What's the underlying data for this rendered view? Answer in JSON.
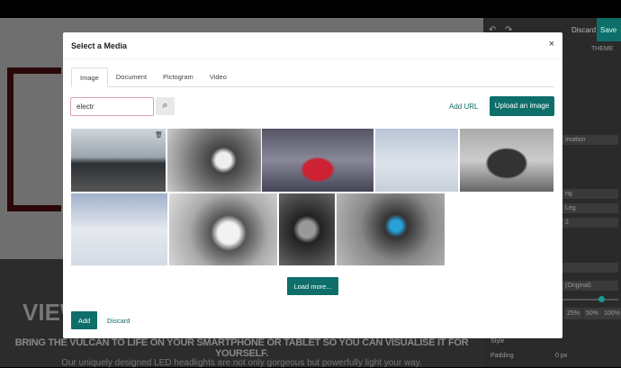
{
  "page": {
    "heading": "VIEW",
    "tagline": "BRING THE VULCAN TO LIFE ON YOUR SMARTPHONE OR TABLET SO YOU CAN VISUALISE IT FOR YOURSELF.",
    "description": "Our uniquely designed LED headlights are not only gorgeous but powerfully light your way."
  },
  "panel": {
    "discard": "Discard",
    "save": "Save",
    "theme": "THEME",
    "rows": [
      "imation",
      "",
      "ng",
      "Leg",
      "2",
      "",
      "(Original)"
    ],
    "percentages": [
      "25%",
      "50%",
      "100%"
    ],
    "style_label": "Style",
    "padding_label": "Padding",
    "padding_value": "0",
    "padding_unit": "px"
  },
  "modal": {
    "title": "Select a Media",
    "close": "×",
    "tabs": [
      {
        "label": "Image",
        "active": true
      },
      {
        "label": "Document"
      },
      {
        "label": "Pictogram"
      },
      {
        "label": "Video"
      }
    ],
    "search": {
      "value": "electr"
    },
    "add_url": "Add URL",
    "upload": "Upload an image",
    "images": [
      "car-highway",
      "ev-charger",
      "red-sports-car-garage",
      "white-suv-snow",
      "black-mustang-road",
      "white-suv-snowfield",
      "ev-charging-plug",
      "charging-port",
      "ev-charger-blue"
    ],
    "load_more": "Load more...",
    "add": "Add",
    "discard": "Discard"
  }
}
